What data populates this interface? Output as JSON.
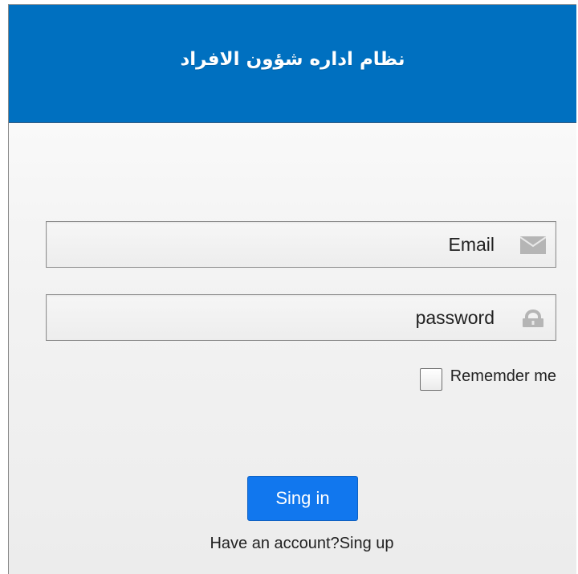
{
  "header": {
    "title": "نظام اداره شؤون الافراد"
  },
  "form": {
    "email_placeholder": "Email",
    "email_icon": "envelope-icon",
    "password_placeholder": "password",
    "password_icon": "lock-icon",
    "remember_label": "Rememder me",
    "remember_checked": false,
    "signin_label": "Sing in",
    "signup_text": "Have an account?Sing up"
  },
  "colors": {
    "header_bg": "#0070c0",
    "button_bg": "#1177ee",
    "icon_gray": "#b5b5b5"
  }
}
